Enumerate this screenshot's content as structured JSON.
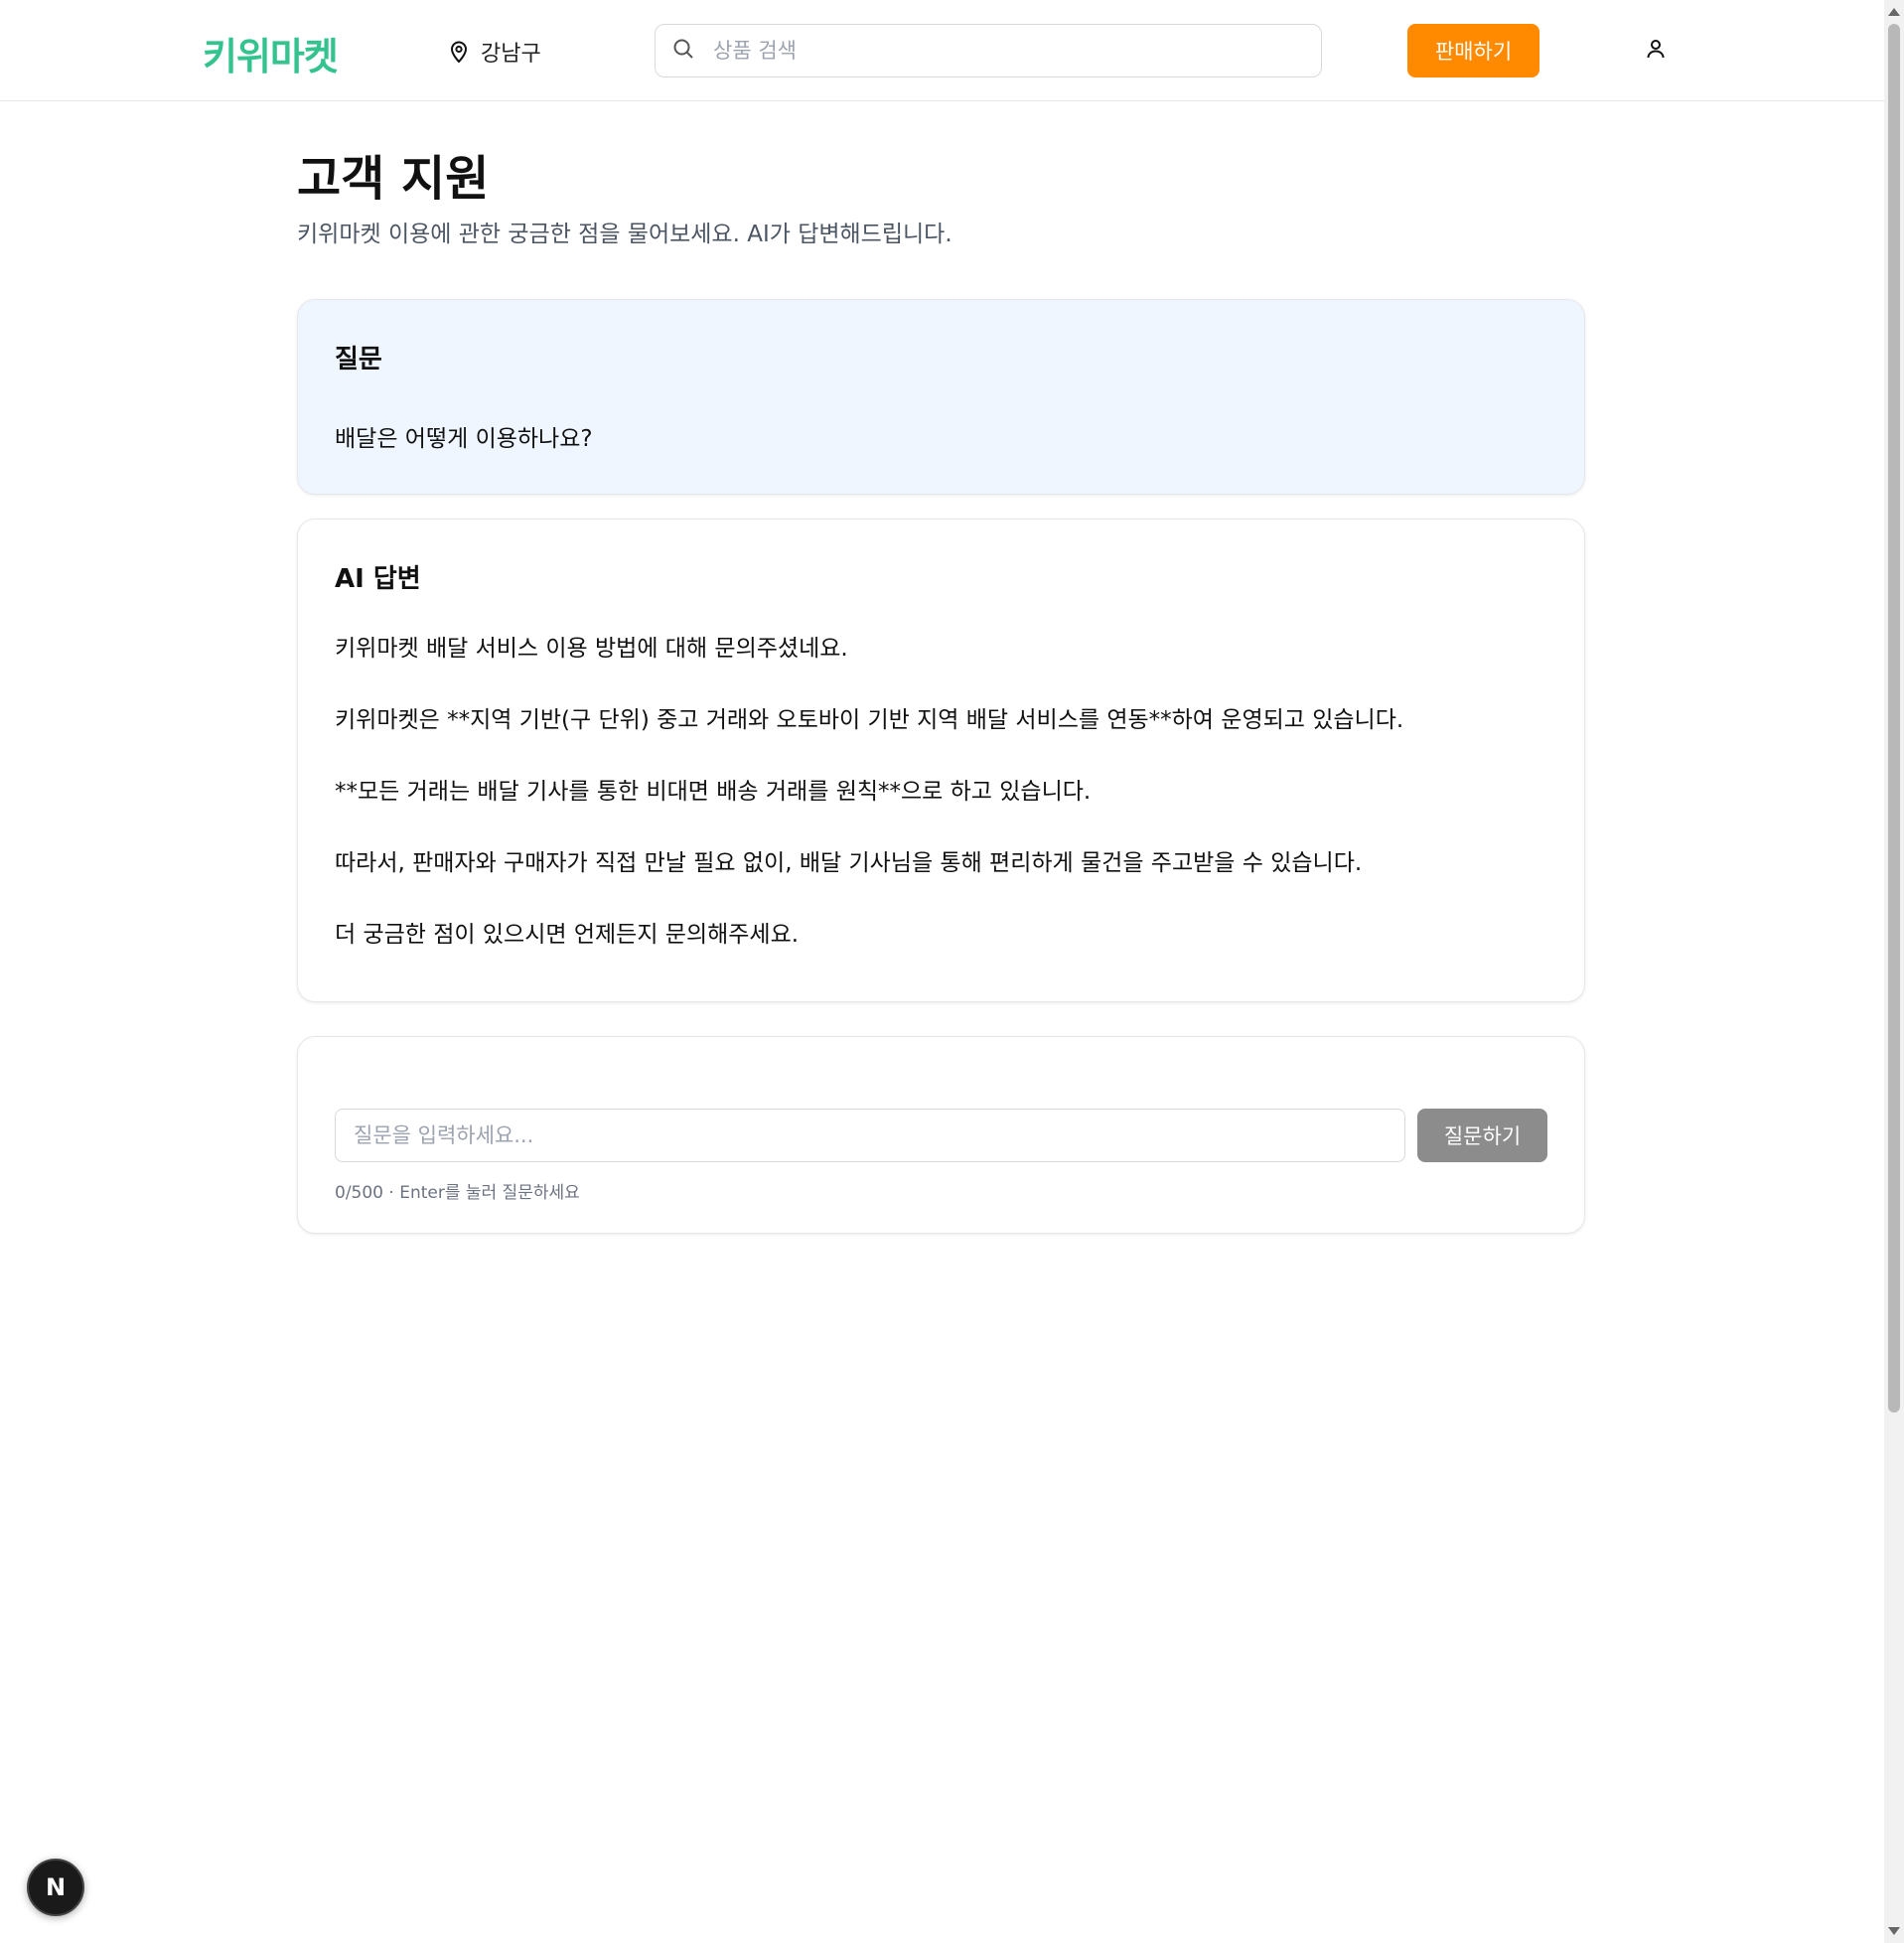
{
  "header": {
    "logo": "키위마켓",
    "location": "강남구",
    "search_placeholder": "상품 검색",
    "sell_button": "판매하기"
  },
  "page": {
    "title": "고객 지원",
    "subtitle": "키위마켓 이용에 관한 궁금한 점을 물어보세요. AI가 답변해드립니다."
  },
  "question_card": {
    "title": "질문",
    "text": "배달은 어떻게 이용하나요?"
  },
  "answer_card": {
    "title": "AI 답변",
    "paragraphs": [
      "키위마켓 배달 서비스 이용 방법에 대해 문의주셨네요.",
      "키위마켓은 **지역 기반(구 단위) 중고 거래와 오토바이 기반 지역 배달 서비스를 연동**하여 운영되고 있습니다.",
      "**모든 거래는 배달 기사를 통한 비대면 배송 거래를 원칙**으로 하고 있습니다.",
      "따라서, 판매자와 구매자가 직접 만날 필요 없이, 배달 기사님을 통해 편리하게 물건을 주고받을 수 있습니다.",
      "더 궁금한 점이 있으시면 언제든지 문의해주세요."
    ]
  },
  "ask_card": {
    "input_placeholder": "질문을 입력하세요...",
    "input_value": "",
    "submit_button": "질문하기",
    "hint": "0/500 · Enter를 눌러 질문하세요"
  },
  "next_badge": "N",
  "colors": {
    "brand": "#34c38f",
    "accent": "#ff8a00",
    "question_bg": "#eff6ff",
    "disabled_button": "#8c8c8c"
  },
  "icons": {
    "location": "map-pin-icon",
    "search": "search-icon",
    "user": "user-icon"
  }
}
